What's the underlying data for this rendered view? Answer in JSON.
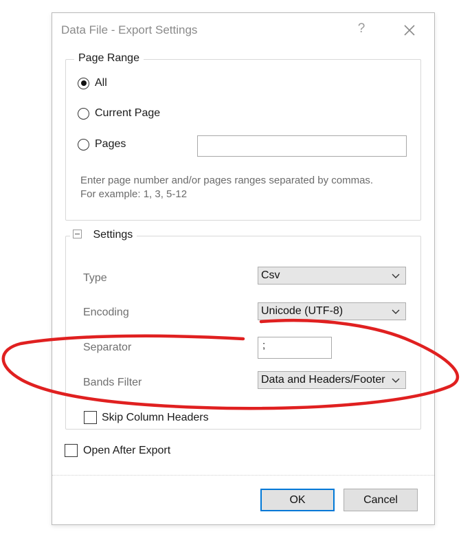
{
  "window": {
    "title": "Data File - Export Settings",
    "help_label": "?",
    "close_icon": "close-icon"
  },
  "page_range": {
    "legend": "Page Range",
    "options": [
      {
        "label": "All",
        "selected": true
      },
      {
        "label": "Current Page",
        "selected": false
      },
      {
        "label": "Pages",
        "selected": false
      }
    ],
    "pages_value": "",
    "hint_line1": "Enter page number and/or pages ranges separated by commas.",
    "hint_line2": "For example: 1, 3, 5-12"
  },
  "settings": {
    "legend": "Settings",
    "collapse_icon": "collapse-minus-icon",
    "type_label": "Type",
    "type_value": "Csv",
    "encoding_label": "Encoding",
    "encoding_value": "Unicode (UTF-8)",
    "separator_label": "Separator",
    "separator_value": ";",
    "bands_filter_label": "Bands Filter",
    "bands_filter_value": "Data and Headers/Footer",
    "skip_headers_label": "Skip Column Headers",
    "skip_headers_checked": false
  },
  "open_after_export": {
    "label": "Open After Export",
    "checked": false
  },
  "buttons": {
    "ok": "OK",
    "cancel": "Cancel"
  },
  "colors": {
    "accent": "#0078d7",
    "annotation": "#e02020"
  }
}
